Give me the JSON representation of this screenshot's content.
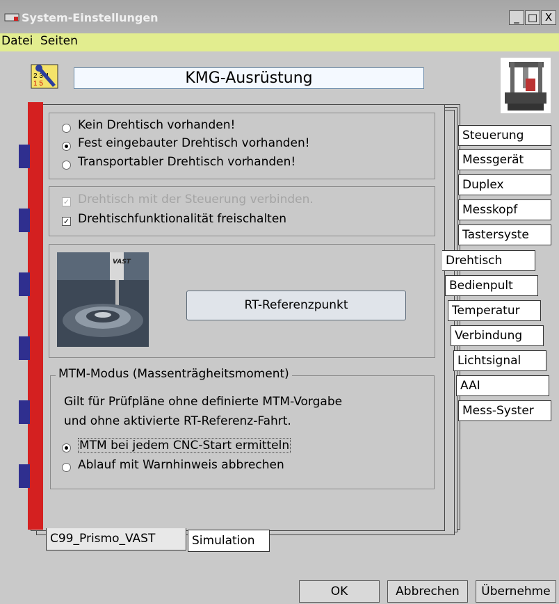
{
  "window": {
    "title": "System-Einstellungen",
    "minimize": "_",
    "maximize": "□",
    "close": "X"
  },
  "menu": [
    "Datei",
    "Seiten"
  ],
  "header": {
    "title": "KMG-Ausrüstung"
  },
  "turntable_options": {
    "none": "Kein Drehtisch vorhanden!",
    "fixed": "Fest eingebauter Drehtisch vorhanden!",
    "portable": "Transportabler Drehtisch vorhanden!",
    "selected": "fixed"
  },
  "checkboxes": {
    "connect_control": {
      "label": "Drehtisch mit der Steuerung verbinden.",
      "checked": true,
      "enabled": false
    },
    "unlock_function": {
      "label": "Drehtischfunktionalität freischalten",
      "checked": true,
      "enabled": true
    }
  },
  "image_text": "VAST",
  "rt_button": "RT-Referenzpunkt",
  "mtm": {
    "group_title": "MTM-Modus (Massenträgheitsmoment)",
    "desc_line1": "Gilt für Prüfpläne ohne definierte MTM-Vorgabe",
    "desc_line2": "und ohne aktivierte RT-Referenz-Fahrt.",
    "opt_determine": "MTM bei jedem CNC-Start ermitteln",
    "opt_abort": "Ablauf mit Warnhinweis abbrechen",
    "selected": "determine"
  },
  "right_tabs": [
    "Steuerung",
    "Messgerät",
    "Duplex",
    "Messkopf",
    "Tastersyste",
    "Drehtisch",
    "Bedienpult",
    "Temperatur",
    "Verbindung",
    "Lichtsignal",
    "AAI",
    "Mess-Syster"
  ],
  "active_right_tab": "Drehtisch",
  "bottom_tabs": [
    "C99_Prismo_VAST",
    "Simulation"
  ],
  "buttons": {
    "ok": "OK",
    "cancel": "Abbrechen",
    "apply": "Übernehme"
  },
  "colors": {
    "menubar": "#e2ed8f",
    "binder_red": "#d42020",
    "binder_blue": "#2f2f8f",
    "background": "#c9c9c9"
  }
}
